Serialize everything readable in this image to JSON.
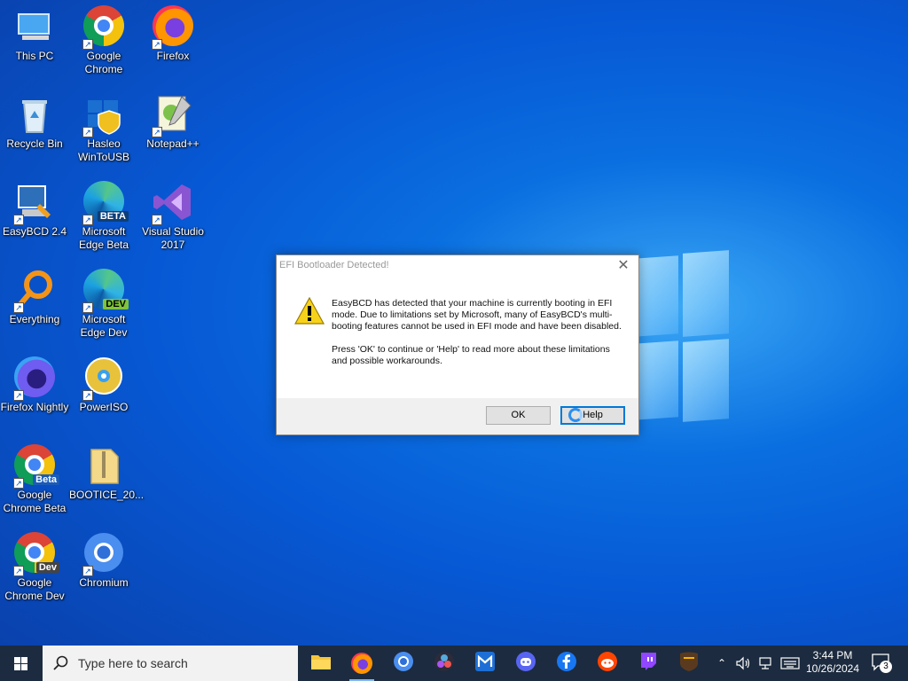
{
  "desktop": {
    "icons": [
      {
        "label": "This PC"
      },
      {
        "label": "Google Chrome"
      },
      {
        "label": "Firefox"
      },
      {
        "label": "Recycle Bin"
      },
      {
        "label": "Hasleo WinToUSB"
      },
      {
        "label": "Notepad++"
      },
      {
        "label": "EasyBCD 2.4"
      },
      {
        "label": "Microsoft Edge Beta",
        "badge": "BETA"
      },
      {
        "label": "Visual Studio 2017"
      },
      {
        "label": "Everything"
      },
      {
        "label": "Microsoft Edge Dev",
        "badge": "DEV"
      },
      {
        "label": "Firefox Nightly"
      },
      {
        "label": "PowerISO"
      },
      {
        "label": "Google Chrome Beta",
        "badge": "Beta"
      },
      {
        "label": "BOOTICE_20..."
      },
      {
        "label": "Google Chrome Dev",
        "badge": "Dev"
      },
      {
        "label": "Chromium"
      }
    ]
  },
  "dialog": {
    "title": "EFI Bootloader Detected!",
    "message1": "EasyBCD has detected that your machine is currently booting in EFI mode. Due to limitations set by Microsoft, many of EasyBCD's multi-booting features cannot be used in EFI mode and have been disabled.",
    "message2": "Press 'OK' to continue or 'Help' to read more about these limitations and possible workarounds.",
    "ok_label": "OK",
    "help_label": "Help",
    "close_glyph": "✕"
  },
  "taskbar": {
    "search_placeholder": "Type here to search",
    "apps": [
      "File Explorer",
      "Firefox",
      "Chromium",
      "DaVinci",
      "Malwarebytes",
      "Discord",
      "Facebook",
      "Reddit",
      "Twitch",
      "UPS"
    ],
    "time": "3:44 PM",
    "date": "10/26/2024",
    "notification_count": "3",
    "chevron_glyph": "⌃"
  },
  "colors": {
    "accent": "#0078d7",
    "taskbar": "#1c2b3f",
    "desktop": "#0758d4"
  }
}
